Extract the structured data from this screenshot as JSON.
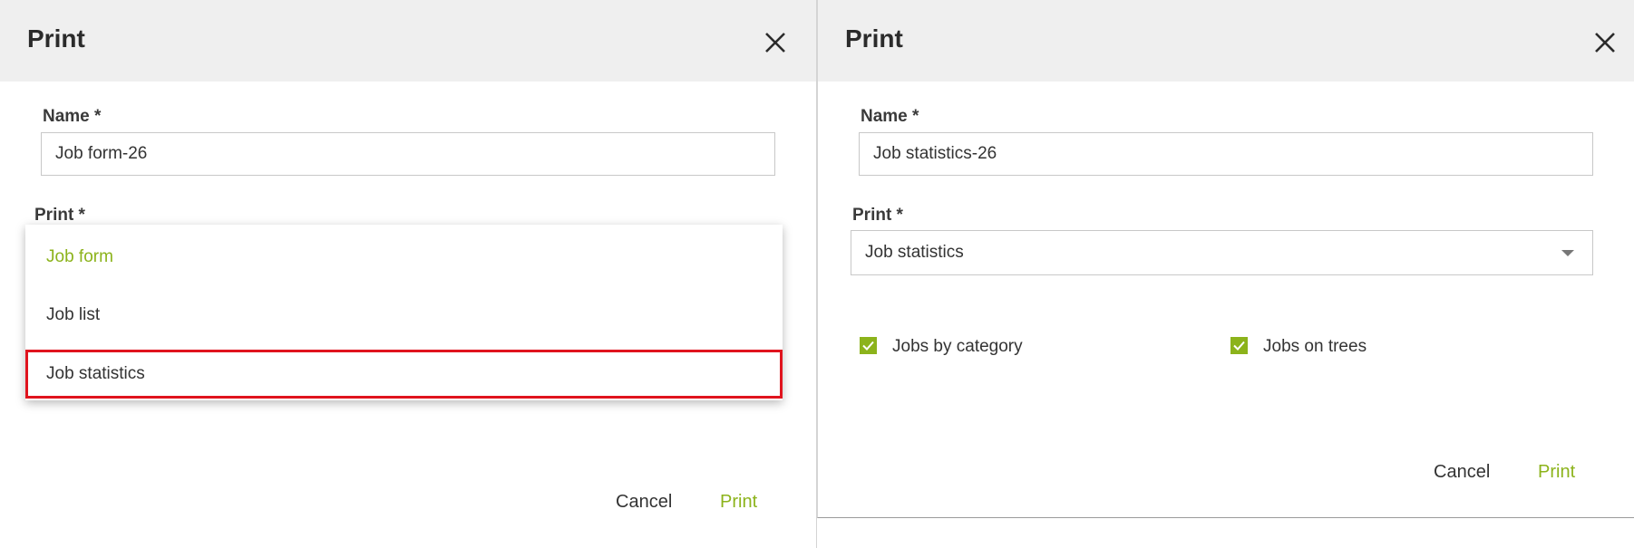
{
  "left_dialog": {
    "title": "Print",
    "name_label": "Name *",
    "name_value": "Job form-26",
    "print_label": "Print *",
    "dropdown_options": [
      {
        "label": "Job form",
        "selected": true
      },
      {
        "label": "Job list",
        "selected": false
      },
      {
        "label": "Job statistics",
        "selected": false,
        "highlighted": true
      }
    ],
    "cancel_label": "Cancel",
    "print_button_label": "Print"
  },
  "right_dialog": {
    "title": "Print",
    "name_label": "Name *",
    "name_value": "Job statistics-26",
    "print_label": "Print *",
    "print_select_value": "Job statistics",
    "checkboxes": [
      {
        "label": "Jobs by category",
        "checked": true
      },
      {
        "label": "Jobs on trees",
        "checked": true
      }
    ],
    "cancel_label": "Cancel",
    "print_button_label": "Print"
  },
  "colors": {
    "accent": "#8cb31b",
    "highlight_border": "#e0141e",
    "header_bg": "#efefef"
  },
  "icons": {
    "close": "close-icon",
    "caret": "chevron-down-icon",
    "check": "check-icon"
  }
}
